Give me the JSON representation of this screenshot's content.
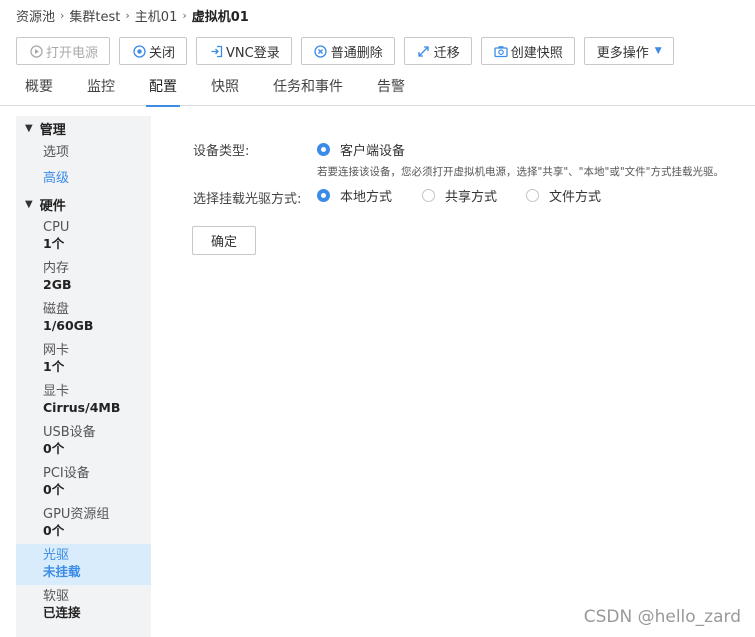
{
  "breadcrumb": [
    "资源池",
    "集群test",
    "主机01",
    "虚拟机01"
  ],
  "toolbar": {
    "power_on": "打开电源",
    "shutdown": "关闭",
    "vnc": "VNC登录",
    "delete": "普通删除",
    "migrate": "迁移",
    "snapshot": "创建快照",
    "more": "更多操作"
  },
  "tabs": [
    "概要",
    "监控",
    "配置",
    "快照",
    "任务和事件",
    "告警"
  ],
  "active_tab": "配置",
  "sidebar": {
    "manage_label": "管理",
    "manage_items": [
      "选项",
      "高级"
    ],
    "hardware_label": "硬件",
    "hardware_items": [
      {
        "label": "CPU",
        "value": "1个"
      },
      {
        "label": "内存",
        "value": "2GB"
      },
      {
        "label": "磁盘",
        "value": "1/60GB"
      },
      {
        "label": "网卡",
        "value": "1个"
      },
      {
        "label": "显卡",
        "value": "Cirrus/4MB"
      },
      {
        "label": "USB设备",
        "value": "0个"
      },
      {
        "label": "PCI设备",
        "value": "0个"
      },
      {
        "label": "GPU资源组",
        "value": "0个"
      },
      {
        "label": "光驱",
        "value": "未挂载"
      },
      {
        "label": "软驱",
        "value": "已连接"
      }
    ]
  },
  "form": {
    "device_type_label": "设备类型:",
    "device_type_option": "客户端设备",
    "hint": "若要连接该设备，您必须打开虚拟机电源，选择\"共享\"、\"本地\"或\"文件\"方式挂载光驱。",
    "mount_label": "选择挂载光驱方式:",
    "mount_options": [
      "本地方式",
      "共享方式",
      "文件方式"
    ],
    "mount_selected": "本地方式",
    "confirm": "确定"
  },
  "watermark": "CSDN @hello_zard",
  "colors": {
    "accent": "#3b8be8",
    "sidebar_bg": "#f2f3f5",
    "selected_bg": "#d9ecfb"
  }
}
